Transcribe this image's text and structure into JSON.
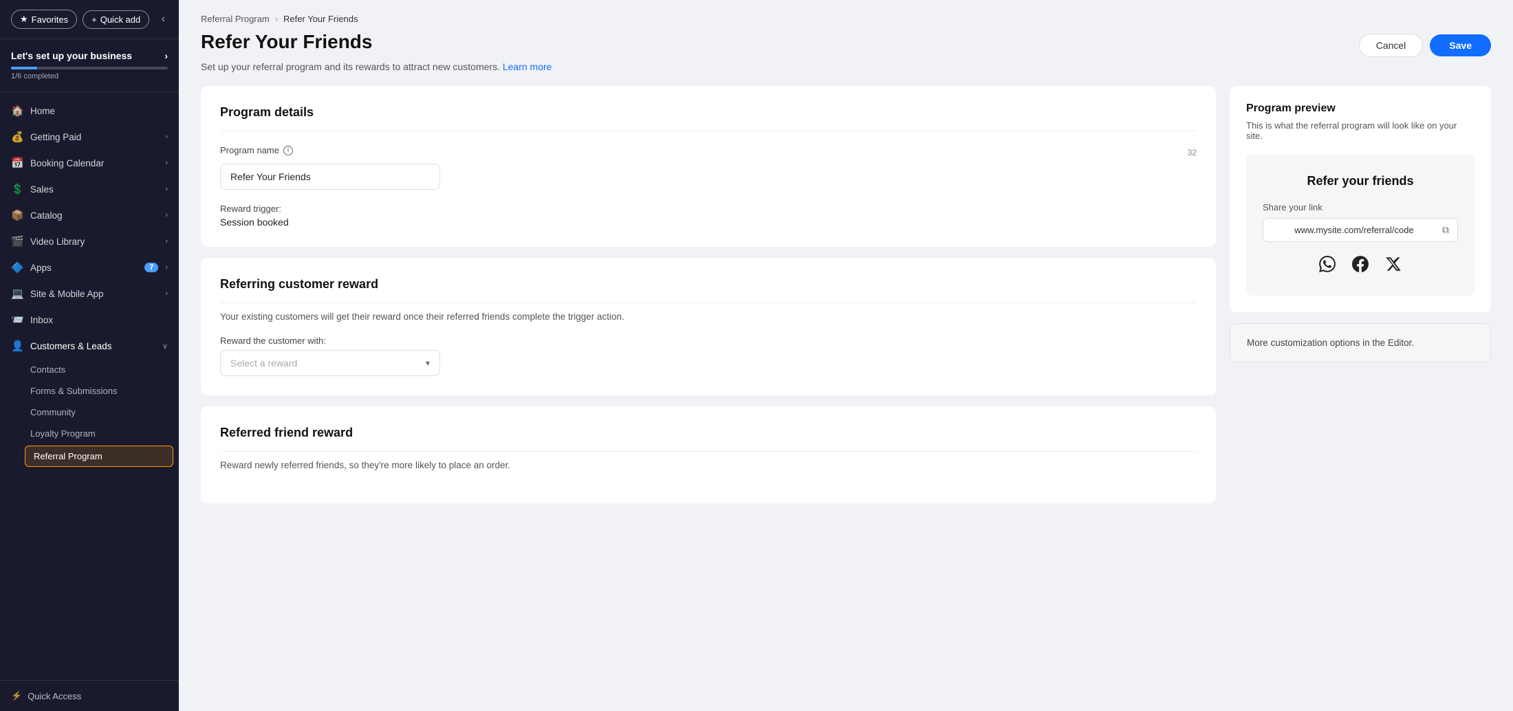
{
  "sidebar": {
    "favorites_label": "Favorites",
    "quick_add_label": "Quick add",
    "business_title": "Let's set up your business",
    "progress_text": "1/6 completed",
    "nav_items": [
      {
        "id": "home",
        "label": "Home",
        "icon": "🏠",
        "has_arrow": false
      },
      {
        "id": "getting-paid",
        "label": "Getting Paid",
        "icon": "💰",
        "has_arrow": true
      },
      {
        "id": "booking-calendar",
        "label": "Booking Calendar",
        "icon": "📅",
        "has_arrow": true
      },
      {
        "id": "sales",
        "label": "Sales",
        "icon": "💲",
        "has_arrow": true
      },
      {
        "id": "catalog",
        "label": "Catalog",
        "icon": "📦",
        "has_arrow": true
      },
      {
        "id": "video-library",
        "label": "Video Library",
        "icon": "🎬",
        "has_arrow": true
      },
      {
        "id": "apps",
        "label": "Apps",
        "icon": "🔷",
        "has_arrow": true,
        "badge": "7"
      },
      {
        "id": "site-mobile",
        "label": "Site & Mobile App",
        "icon": "💻",
        "has_arrow": true
      },
      {
        "id": "inbox",
        "label": "Inbox",
        "icon": "📨",
        "has_arrow": false
      },
      {
        "id": "customers-leads",
        "label": "Customers & Leads",
        "icon": "👤",
        "has_arrow": true,
        "expanded": true
      }
    ],
    "sub_items": [
      {
        "id": "contacts",
        "label": "Contacts"
      },
      {
        "id": "forms-submissions",
        "label": "Forms & Submissions"
      },
      {
        "id": "community",
        "label": "Community"
      },
      {
        "id": "loyalty-program",
        "label": "Loyalty Program"
      },
      {
        "id": "referral-program",
        "label": "Referral Program",
        "active": true
      }
    ],
    "quick_access_label": "Quick Access"
  },
  "breadcrumb": {
    "parent": "Referral Program",
    "current": "Refer Your Friends"
  },
  "header": {
    "page_title": "Refer Your Friends",
    "page_subtitle": "Set up your referral program and its rewards to attract new customers.",
    "learn_more": "Learn more",
    "cancel_label": "Cancel",
    "save_label": "Save"
  },
  "program_details": {
    "section_title": "Program details",
    "name_label": "Program name",
    "name_char_count": "32",
    "name_value": "Refer Your Friends",
    "name_placeholder": "Refer Your Friends",
    "reward_trigger_label": "Reward trigger:",
    "reward_trigger_value": "Session booked"
  },
  "referring_reward": {
    "section_title": "Referring customer reward",
    "description": "Your existing customers will get their reward once their referred friends complete the trigger action.",
    "reward_label": "Reward the customer with:",
    "reward_placeholder": "Select a reward"
  },
  "referred_reward": {
    "section_title": "Referred friend reward",
    "description": "Reward newly referred friends, so they're more likely to place an order."
  },
  "preview": {
    "title": "Program preview",
    "description": "This is what the referral program will look like on your site.",
    "mockup_title": "Refer your friends",
    "share_link_label": "Share your link",
    "share_link_value": "www.mysite.com/referral/code",
    "editor_note": "More customization options in the Editor."
  }
}
